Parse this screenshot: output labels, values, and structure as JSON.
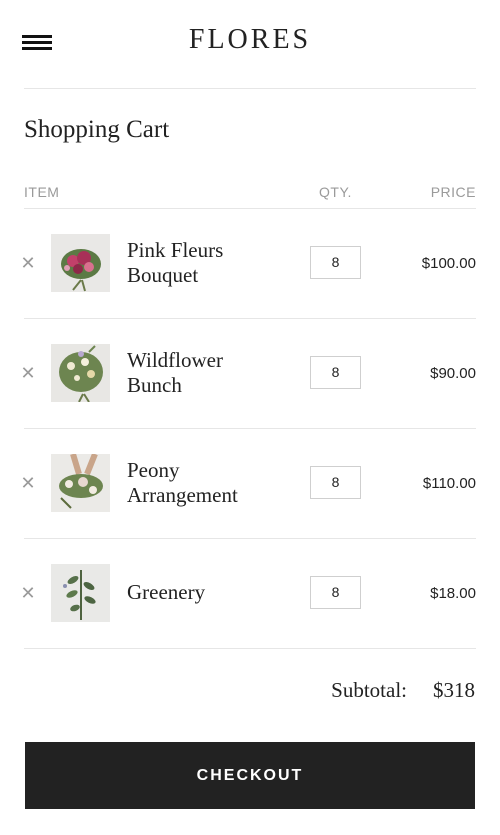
{
  "header": {
    "brand": "FLORES",
    "menu_icon": "hamburger-menu-icon"
  },
  "page": {
    "title": "Shopping Cart"
  },
  "table": {
    "columns": {
      "item": "ITEM",
      "qty": "QTY.",
      "price": "PRICE"
    },
    "rows": [
      {
        "name_line1": "Pink Fleurs",
        "name_line2": "Bouquet",
        "qty": "8",
        "price": "$100.00",
        "remove_icon": "close-icon"
      },
      {
        "name_line1": "Wildflower",
        "name_line2": "Bunch",
        "qty": "8",
        "price": "$90.00",
        "remove_icon": "close-icon"
      },
      {
        "name_line1": "Peony",
        "name_line2": "Arrangement",
        "qty": "8",
        "price": "$110.00",
        "remove_icon": "close-icon"
      },
      {
        "name_line1": "Greenery",
        "name_line2": "",
        "qty": "8",
        "price": "$18.00",
        "remove_icon": "close-icon"
      }
    ]
  },
  "summary": {
    "subtotal_label": "Subtotal:",
    "subtotal_value": "$318"
  },
  "actions": {
    "checkout_label": "CHECKOUT"
  },
  "colors": {
    "button_bg": "#222222",
    "divider": "#e6e6e6",
    "muted_text": "#9a9a9a"
  }
}
